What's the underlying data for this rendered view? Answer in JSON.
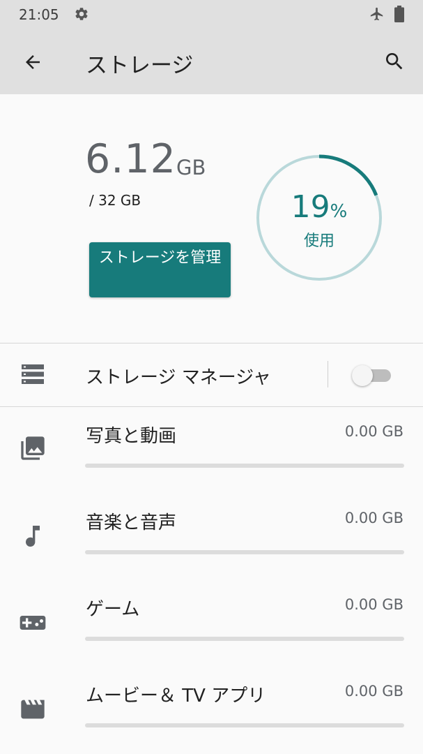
{
  "status_bar": {
    "time": "21:05",
    "icons": [
      "settings-gear-icon",
      "airplane-mode-icon",
      "battery-icon"
    ]
  },
  "app_bar": {
    "title": "ストレージ",
    "back_icon": "arrow-back-icon",
    "search_icon": "search-icon"
  },
  "summary": {
    "used_value": "6.12",
    "used_unit": "GB",
    "total": "/ 32 GB",
    "manage_button": "ストレージを管理",
    "percent_value": "19",
    "percent_sign": "%",
    "percent_label": "使用",
    "percent_fraction": 0.19,
    "accent_color": "#177b7b",
    "ring_track_color": "#b9d8da"
  },
  "storage_manager": {
    "label": "ストレージ マネージャ",
    "icon": "storage-list-icon",
    "enabled": false
  },
  "categories": [
    {
      "label": "写真と動画",
      "size": "0.00 GB",
      "icon": "photo-library-icon",
      "fraction": 0
    },
    {
      "label": "音楽と音声",
      "size": "0.00 GB",
      "icon": "music-note-icon",
      "fraction": 0
    },
    {
      "label": "ゲーム",
      "size": "0.00 GB",
      "icon": "gamepad-icon",
      "fraction": 0
    },
    {
      "label": "ムービー＆ TV アプリ",
      "size": "0.00 GB",
      "icon": "movie-clapper-icon",
      "fraction": 0
    }
  ]
}
